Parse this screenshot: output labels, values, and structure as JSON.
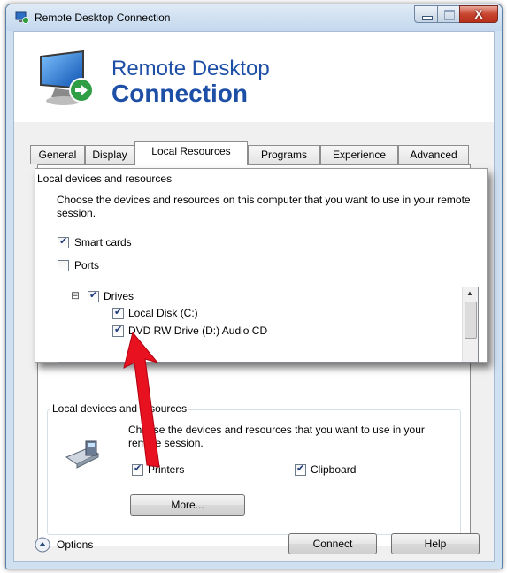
{
  "window": {
    "title": "Remote Desktop Connection",
    "close_glyph": "X"
  },
  "header": {
    "line1": "Remote Desktop",
    "line2": "Connection"
  },
  "tabs": [
    {
      "label": "General"
    },
    {
      "label": "Display"
    },
    {
      "label": "Local Resources"
    },
    {
      "label": "Programs"
    },
    {
      "label": "Experience"
    },
    {
      "label": "Advanced"
    }
  ],
  "zoom": {
    "group_title": "Local devices and resources",
    "description": "Choose the devices and resources on this computer that you want to use in your remote session.",
    "smart_cards": "Smart cards",
    "ports": "Ports",
    "tree": {
      "expander": "⊟",
      "drives": "Drives",
      "local_disk": "Local Disk (C:)",
      "dvd": "DVD RW Drive (D:) Audio CD"
    },
    "scroll_up": "▲"
  },
  "local_devices": {
    "group_title": "Local devices and resources",
    "description": "Choose the devices and resources that you want to use in your remote session.",
    "printers": "Printers",
    "clipboard": "Clipboard",
    "more_button": "More..."
  },
  "footer": {
    "options_label": "Options",
    "options_glyph": "⌃",
    "connect_button": "Connect",
    "help_button": "Help"
  },
  "colors": {
    "header_text": "#1e4fa6",
    "arrow": "#e8111f"
  }
}
